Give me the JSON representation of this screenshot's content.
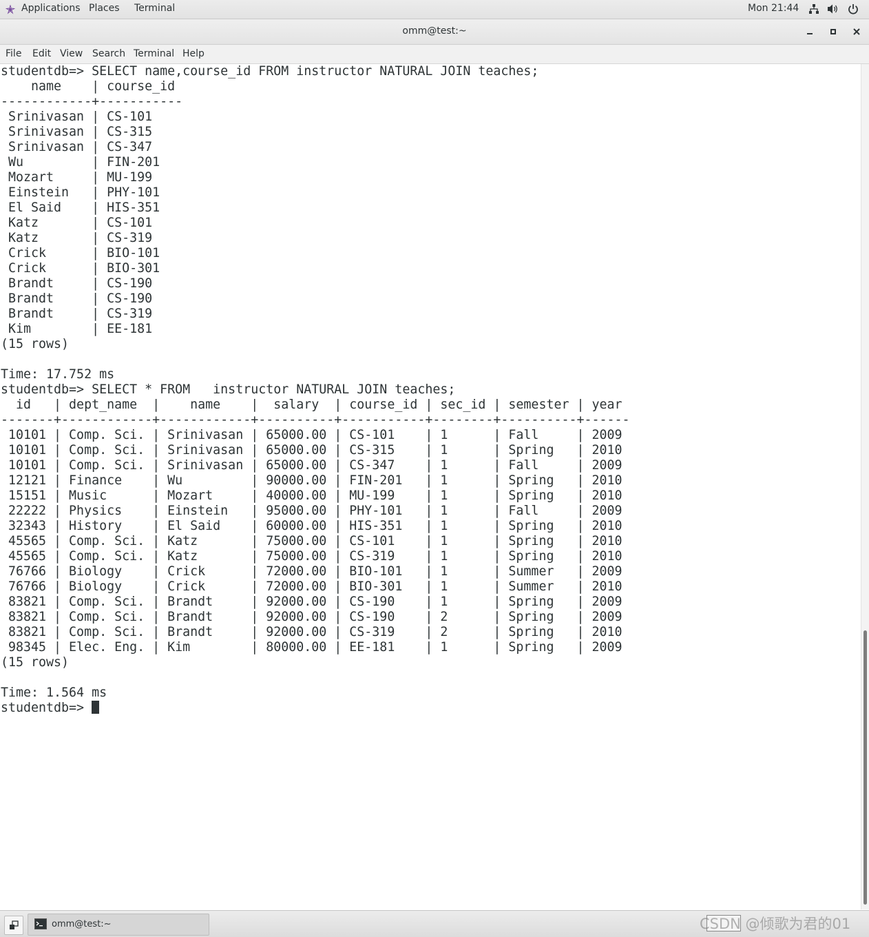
{
  "topbar": {
    "applications": "Applications",
    "places": "Places",
    "terminal": "Terminal",
    "clock": "Mon 21:44"
  },
  "window": {
    "title": "omm@test:~"
  },
  "menubar": {
    "items": [
      "File",
      "Edit",
      "View",
      "Search",
      "Terminal",
      "Help"
    ]
  },
  "terminal": {
    "lines": [
      "studentdb=> SELECT name,course_id FROM instructor NATURAL JOIN teaches;",
      "    name    | course_id ",
      "------------+-----------",
      " Srinivasan | CS-101",
      " Srinivasan | CS-315",
      " Srinivasan | CS-347",
      " Wu         | FIN-201",
      " Mozart     | MU-199",
      " Einstein   | PHY-101",
      " El Said    | HIS-351",
      " Katz       | CS-101",
      " Katz       | CS-319",
      " Crick      | BIO-101",
      " Crick      | BIO-301",
      " Brandt     | CS-190",
      " Brandt     | CS-190",
      " Brandt     | CS-319",
      " Kim        | EE-181",
      "(15 rows)",
      "",
      "Time: 17.752 ms",
      "studentdb=> SELECT * FROM   instructor NATURAL JOIN teaches;",
      "  id   | dept_name  |    name    |  salary  | course_id | sec_id | semester | year ",
      "-------+------------+------------+----------+-----------+--------+----------+------",
      " 10101 | Comp. Sci. | Srinivasan | 65000.00 | CS-101    | 1      | Fall     | 2009",
      " 10101 | Comp. Sci. | Srinivasan | 65000.00 | CS-315    | 1      | Spring   | 2010",
      " 10101 | Comp. Sci. | Srinivasan | 65000.00 | CS-347    | 1      | Fall     | 2009",
      " 12121 | Finance    | Wu         | 90000.00 | FIN-201   | 1      | Spring   | 2010",
      " 15151 | Music      | Mozart     | 40000.00 | MU-199    | 1      | Spring   | 2010",
      " 22222 | Physics    | Einstein   | 95000.00 | PHY-101   | 1      | Fall     | 2009",
      " 32343 | History    | El Said    | 60000.00 | HIS-351   | 1      | Spring   | 2010",
      " 45565 | Comp. Sci. | Katz       | 75000.00 | CS-101    | 1      | Spring   | 2010",
      " 45565 | Comp. Sci. | Katz       | 75000.00 | CS-319    | 1      | Spring   | 2010",
      " 76766 | Biology    | Crick      | 72000.00 | BIO-101   | 1      | Summer   | 2009",
      " 76766 | Biology    | Crick      | 72000.00 | BIO-301   | 1      | Summer   | 2010",
      " 83821 | Comp. Sci. | Brandt     | 92000.00 | CS-190    | 1      | Spring   | 2009",
      " 83821 | Comp. Sci. | Brandt     | 92000.00 | CS-190    | 2      | Spring   | 2009",
      " 83821 | Comp. Sci. | Brandt     | 92000.00 | CS-319    | 2      | Spring   | 2010",
      " 98345 | Elec. Eng. | Kim        | 80000.00 | EE-181    | 1      | Spring   | 2009",
      "(15 rows)",
      "",
      "Time: 1.564 ms"
    ],
    "prompt": "studentdb=> "
  },
  "taskbar": {
    "task_label": "omm@test:~"
  },
  "watermark": "CSDN @倾歌为君的01",
  "colors": {
    "terminal_fg": "#2e3436",
    "terminal_bg": "#ffffff",
    "topbar_bg": "#e6e6e6"
  }
}
